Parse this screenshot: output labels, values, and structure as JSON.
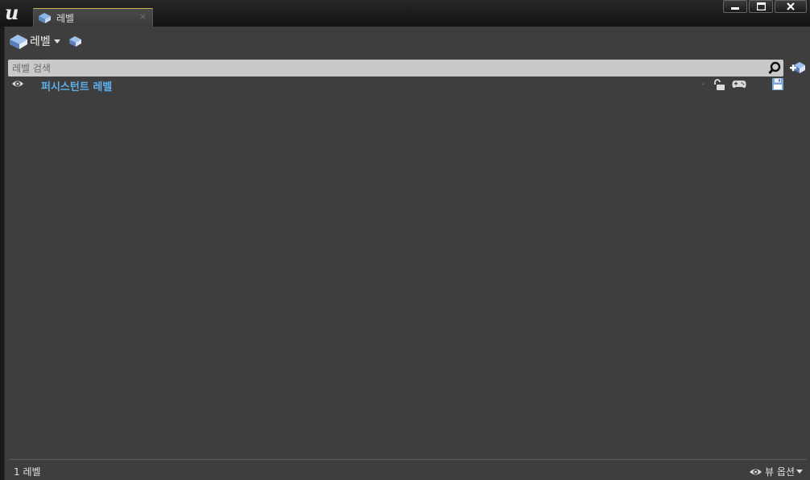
{
  "window": {
    "tab_label": "레벨",
    "tab_close_glyph": "×",
    "logo_glyph": "u",
    "accent_color": "#c7b24e"
  },
  "toolbar": {
    "levels_menu_label": "레벨"
  },
  "search": {
    "placeholder": "레벨 검색"
  },
  "levels": [
    {
      "name": "퍼시스턴트 레벨",
      "name_color": "#5fb0ea"
    }
  ],
  "footer": {
    "count_label": "1 레벨",
    "view_options_label": "뷰 옵션"
  },
  "icons": [
    "levels-icon",
    "level-details-icon",
    "search-icon",
    "add-level-icon",
    "eye-icon",
    "lock-icon",
    "gamepad-icon",
    "save-icon",
    "minimize-icon",
    "maximize-icon",
    "close-icon"
  ]
}
